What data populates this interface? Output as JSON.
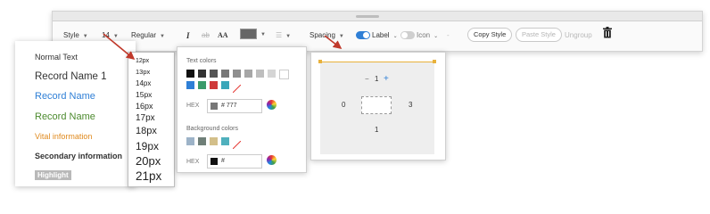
{
  "toolbar": {
    "style_label": "Style",
    "font_size": "14",
    "font_weight": "Regular",
    "italic_glyph": "I",
    "strike_glyph": "ab",
    "caps_glyph": "AA",
    "color_swatch": "#666666",
    "spacing_label": "Spacing",
    "label_toggle": "Label",
    "icon_toggle": "Icon",
    "dash": "-",
    "copy_style": "Copy Style",
    "paste_style": "Paste Style",
    "ungroup": "Ungroup",
    "delete_icon": "trash-icon"
  },
  "styles": [
    {
      "label": "Normal Text",
      "color": "#222222"
    },
    {
      "label": "Record Name 1",
      "color": "#222222"
    },
    {
      "label": "Record Name",
      "color": "#2f7fd6"
    },
    {
      "label": "Record Name",
      "color": "#4c8a2e"
    },
    {
      "label": "Vital information",
      "color": "#e08a1e"
    },
    {
      "label": "Secondary information",
      "color": "#333333"
    },
    {
      "label": "Highlight",
      "color": "#ffffff",
      "background": "#b9b9b9"
    }
  ],
  "font_sizes": [
    "12px",
    "13px",
    "14px",
    "15px",
    "16px",
    "17px",
    "18px",
    "19px",
    "20px",
    "21px"
  ],
  "color_panel": {
    "text_colors_title": "Text colors",
    "text_swatches_row1": [
      "#111111",
      "#333333",
      "#555555",
      "#777777",
      "#8f8f8f",
      "#a7a7a7",
      "#bebebe",
      "#d5d5d5",
      "#ffffff"
    ],
    "text_swatches_row2": [
      "#2f7fd6",
      "#3a9a6a",
      "#cf3a3a",
      "#3aa6b9"
    ],
    "hex_label": "HEX",
    "text_hex_value": "# 777",
    "text_hex_chip": "#777777",
    "bg_colors_title": "Background colors",
    "bg_swatches": [
      "#9db3c8",
      "#6f7f78",
      "#d3bf8a",
      "#4fb0bd"
    ],
    "bg_hex_value": "#",
    "bg_hex_chip": "#111111"
  },
  "spacing_panel": {
    "minus": "−",
    "top_value": "1",
    "plus": "+",
    "left_value": "0",
    "right_value": "3",
    "bottom_value": "1"
  }
}
